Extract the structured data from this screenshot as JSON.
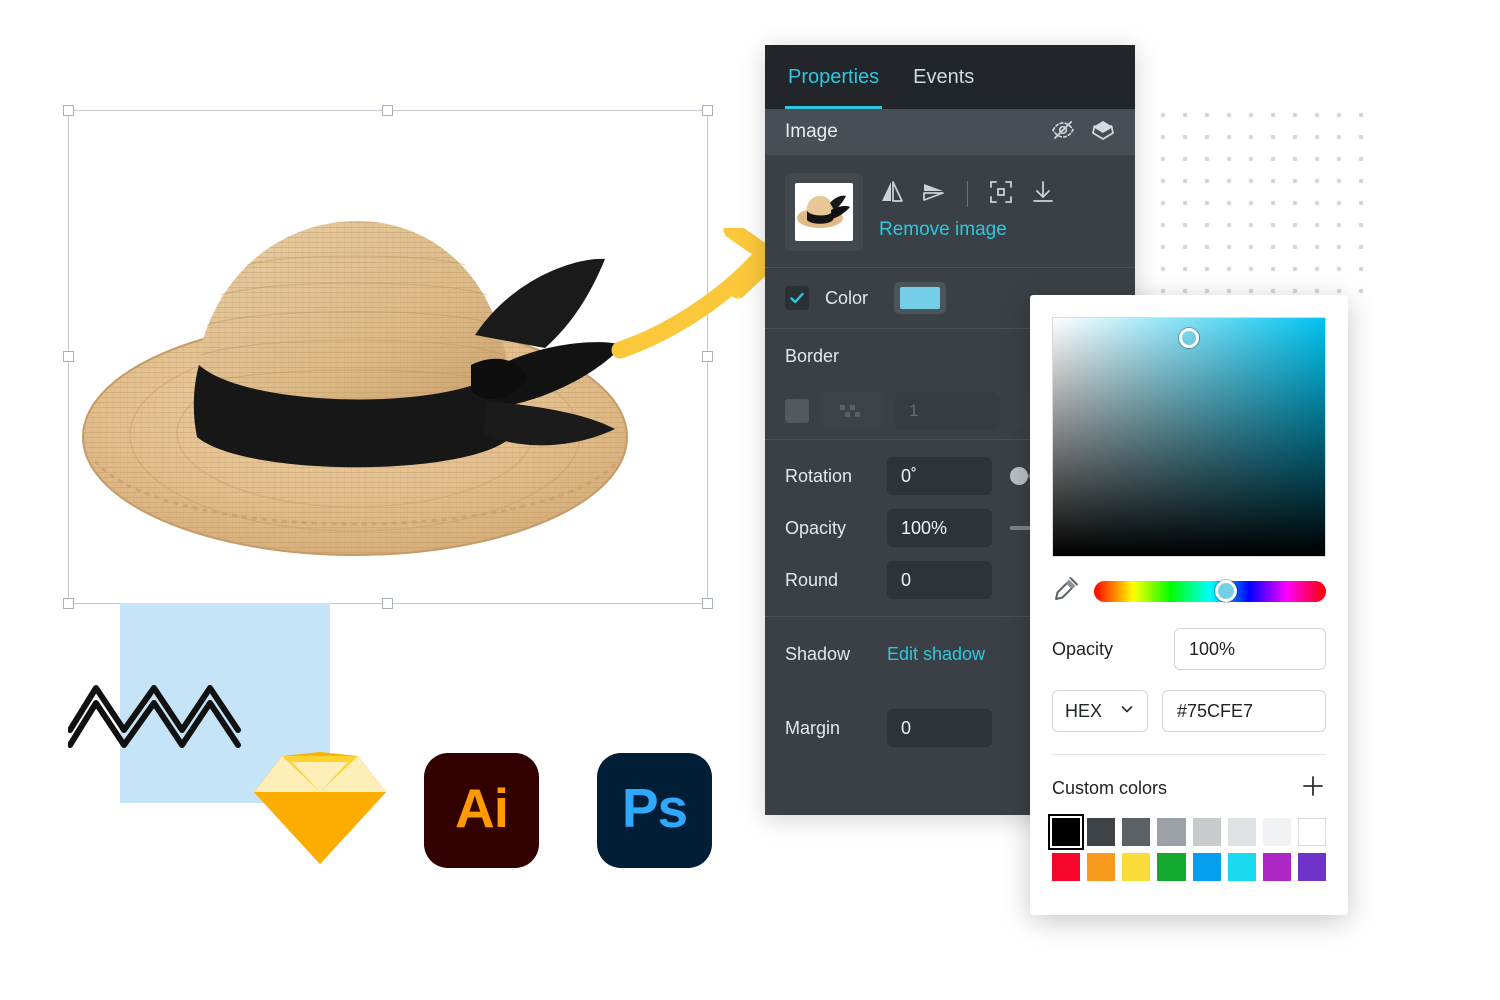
{
  "canvas": {
    "selection_label": "image-selection-frame",
    "artboard_bg": "#ffffff"
  },
  "logos": [
    {
      "name": "sketch",
      "label": "Sketch"
    },
    {
      "name": "adobe-illustrator",
      "label": "Ai",
      "bg": "#330000",
      "fg": "#FF9A00"
    },
    {
      "name": "adobe-photoshop",
      "label": "Ps",
      "bg": "#001E36",
      "fg": "#31A8FF"
    }
  ],
  "properties_panel": {
    "tabs": [
      {
        "id": "properties",
        "label": "Properties",
        "active": true
      },
      {
        "id": "events",
        "label": "Events",
        "active": false
      }
    ],
    "section_title": "Image",
    "header_icons": [
      {
        "name": "eye-off-icon",
        "title": "Hide"
      },
      {
        "name": "layers-icon",
        "title": "Layers"
      }
    ],
    "image_tools": [
      {
        "name": "flip-horizontal-icon"
      },
      {
        "name": "flip-vertical-icon"
      },
      {
        "name": "fit-icon"
      },
      {
        "name": "download-icon"
      }
    ],
    "remove_image_label": "Remove image",
    "color_row": {
      "label": "Color",
      "checked": true,
      "swatch": "#75CFE7"
    },
    "border_row": {
      "label": "Border",
      "checked": true,
      "enabled": false,
      "width": "1"
    },
    "rotation": {
      "label": "Rotation",
      "value": "0˚"
    },
    "opacity": {
      "label": "Opacity",
      "value": "100%"
    },
    "round": {
      "label": "Round",
      "value": "0",
      "checked": true
    },
    "shadow": {
      "label": "Shadow",
      "action_label": "Edit shadow"
    },
    "margin": {
      "label": "Margin",
      "value": "0",
      "checked": true
    },
    "accent_color": "#2ec7dc",
    "panel_bg": "#3a4046"
  },
  "color_picker": {
    "current_color": "#75CFE7",
    "hue_color": "#00c3f0",
    "eyedropper_name": "eyedropper-icon",
    "opacity": {
      "label": "Opacity",
      "value": "100%"
    },
    "format": {
      "selected": "HEX",
      "value": "#75CFE7"
    },
    "custom_colors": {
      "title": "Custom colors",
      "add_label": "+",
      "swatches": [
        "#000000",
        "#3d4246",
        "#5b6166",
        "#9ba1a6",
        "#c7cbce",
        "#dfe2e4",
        "#f0f2f3",
        "#ffffff",
        "#f5062a",
        "#f79a1e",
        "#fbdc3a",
        "#14a82e",
        "#04a0ee",
        "#1adaf0",
        "#ad27c4",
        "#6f33c9"
      ],
      "selected_index": 0
    }
  }
}
